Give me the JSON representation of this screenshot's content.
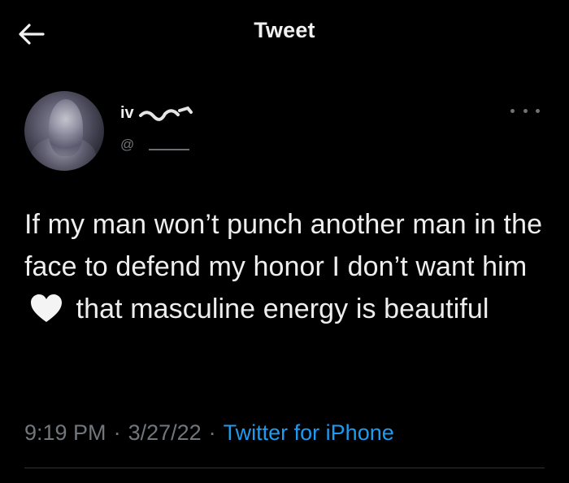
{
  "header": {
    "title": "Tweet",
    "back_icon": "arrow-left-icon"
  },
  "author": {
    "display_name_visible": "iv",
    "handle_visible": "@",
    "avatar": "profile-avatar-image",
    "more_icon": "more-horizontal-icon"
  },
  "tweet": {
    "text_before_emoji": "If my man won’t punch another man in the face to defend my honor I don’t want him",
    "emoji": "white-heart-icon",
    "text_after_emoji": "that masculine energy is beautiful"
  },
  "meta": {
    "time": "9:19 PM",
    "separator1": "·",
    "date": "3/27/22",
    "separator2": "·",
    "source": "Twitter for iPhone"
  },
  "colors": {
    "background": "#000000",
    "text": "#eeeeee",
    "secondary": "#71767b",
    "link": "#1d9bf0",
    "divider": "#2f3336"
  }
}
